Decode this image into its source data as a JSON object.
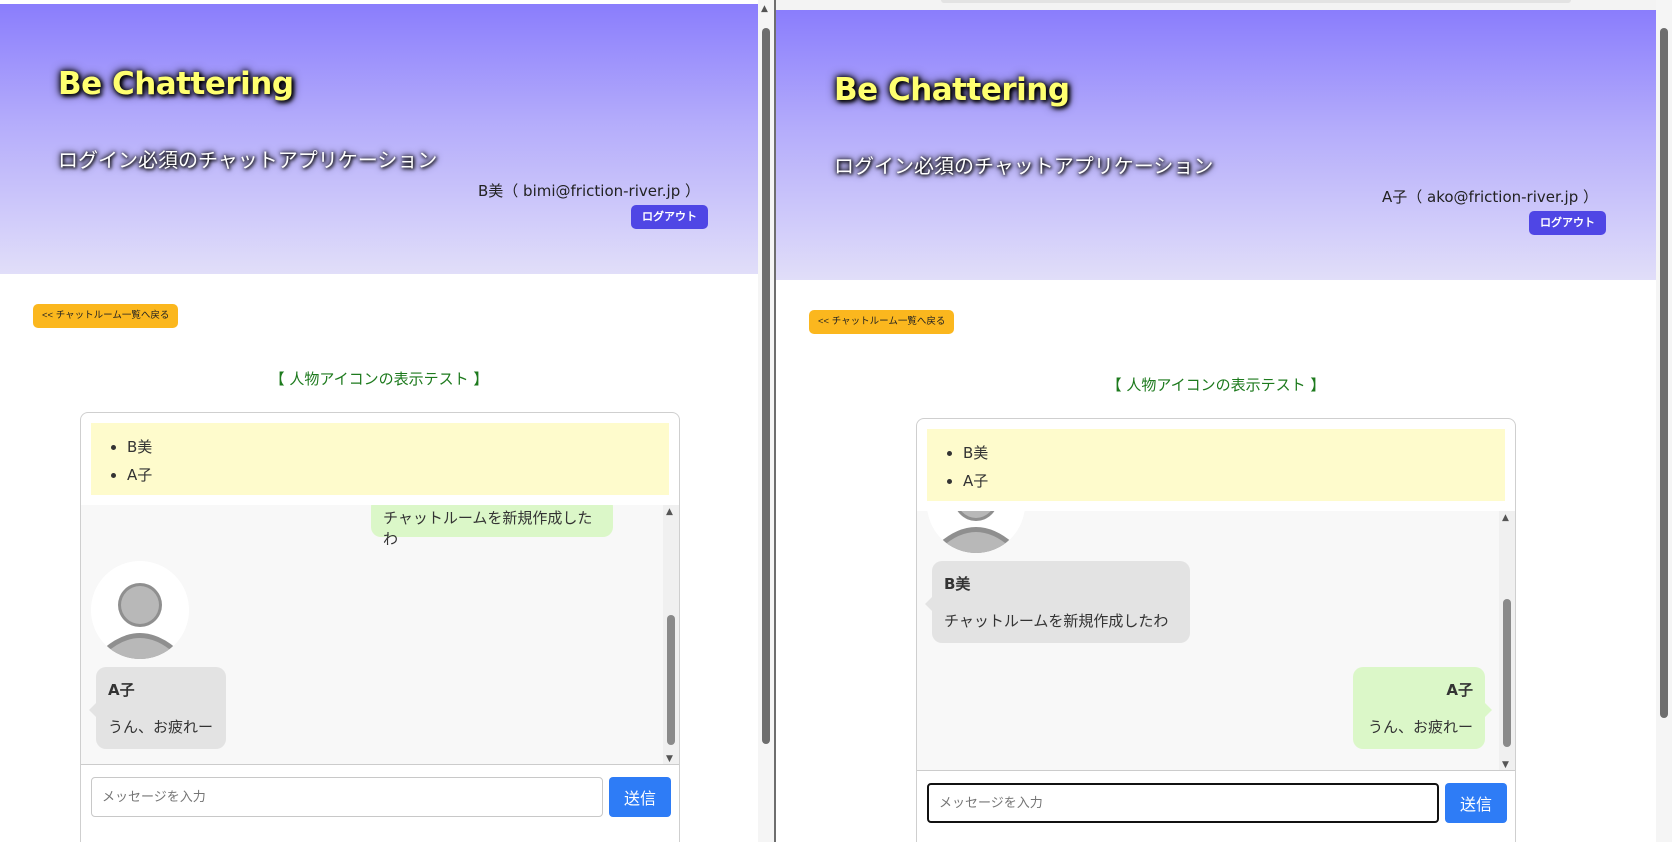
{
  "site": {
    "title": "Be Chattering",
    "subtitle": "ログイン必須のチャットアプリケーション",
    "logout_label": "ログアウト",
    "back_label": "<< チャットルーム一覧へ戻る",
    "room_title": "【 人物アイコンの表示テスト 】",
    "input_placeholder": "メッセージを入力",
    "send_label": "送信"
  },
  "left_window": {
    "user": "B美（ bimi@friction-river.jp ）",
    "members": [
      "B美",
      "A子"
    ],
    "messages": [
      {
        "sender": "",
        "text": "チャットルームを新規作成したわ",
        "own": true
      },
      {
        "sender": "A子",
        "text": "うん、お疲れー",
        "own": false
      }
    ]
  },
  "right_window": {
    "user": "A子（ ako@friction-river.jp ）",
    "members": [
      "B美",
      "A子"
    ],
    "messages": [
      {
        "sender": "B美",
        "text": "チャットルームを新規作成したわ",
        "own": false
      },
      {
        "sender": "A子",
        "text": "うん、お疲れー",
        "own": true
      }
    ]
  },
  "icons": {
    "avatar": "person-silhouette-icon",
    "scroll_up": "▲",
    "scroll_down": "▼"
  },
  "colors": {
    "header_top": "#8a7dfc",
    "header_bottom": "#e1def9",
    "title_text": "#ffff70",
    "logout_button": "#4f46e5",
    "back_button": "#fbb71e",
    "room_title": "#1d7a1d",
    "members_bg": "#fefbcc",
    "own_bubble": "#dbf7c8",
    "other_bubble": "#e3e3e3",
    "send_button": "#2e7cf6"
  }
}
